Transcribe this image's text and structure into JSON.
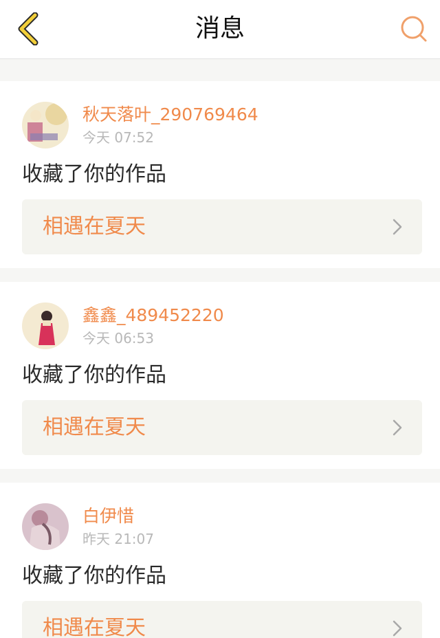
{
  "header": {
    "title": "消息"
  },
  "messages": [
    {
      "user_name": "秋天落叶_290769464",
      "time": "今天 07:52",
      "action": "收藏了你的作品",
      "work_title": "相遇在夏天",
      "avatar_colors": [
        "#e9d6a0",
        "#f5e6c8",
        "#c46a8a",
        "#8a7fb0"
      ]
    },
    {
      "user_name": "鑫鑫_489452220",
      "time": "今天 06:53",
      "action": "收藏了你的作品",
      "work_title": "相遇在夏天",
      "avatar_colors": [
        "#f4ead2",
        "#efe2c2",
        "#d8325a",
        "#3a2a2a"
      ]
    },
    {
      "user_name": "白伊惜",
      "time": "昨天 21:07",
      "action": "收藏了你的作品",
      "work_title": "相遇在夏天",
      "avatar_colors": [
        "#d9c2cc",
        "#b88a9a",
        "#e6d4d9",
        "#7a5a66"
      ]
    }
  ],
  "colors": {
    "accent": "#f08a4b",
    "back_icon": "#f2cf3a",
    "search_icon": "#f0a06a"
  }
}
